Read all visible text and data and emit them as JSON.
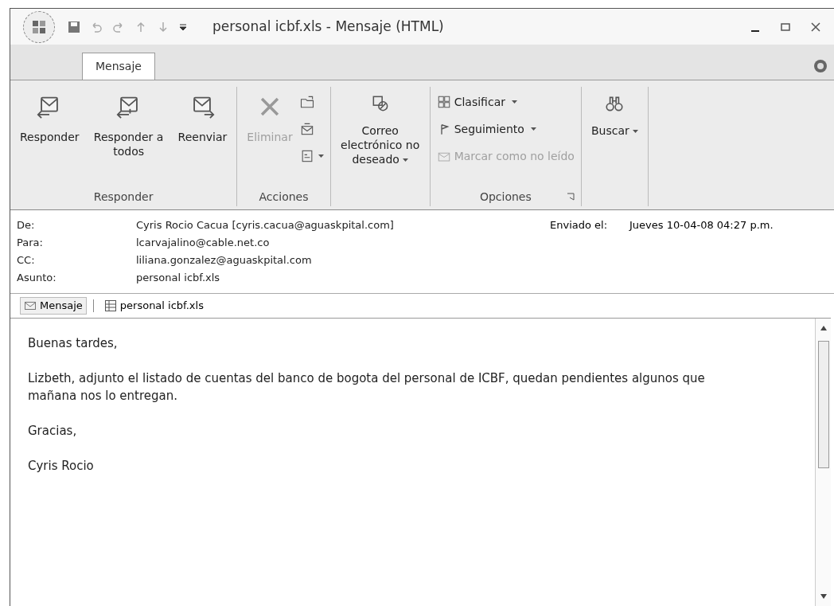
{
  "window": {
    "title": "personal icbf.xls - Mensaje (HTML)"
  },
  "ribbon_tabs": [
    {
      "label": "Mensaje",
      "selected": true
    }
  ],
  "ribbon_groups": [
    {
      "label": "Responder",
      "launcher": false,
      "items": [
        {
          "kind": "large",
          "label": "Responder",
          "disabled": false,
          "dropdown": false
        },
        {
          "kind": "large",
          "label": "Responder a todos",
          "disabled": false,
          "dropdown": false
        },
        {
          "kind": "large",
          "label": "Reenviar",
          "disabled": false,
          "dropdown": false
        }
      ]
    },
    {
      "label": "Acciones",
      "launcher": false,
      "items": [
        {
          "kind": "large",
          "label": "Eliminar",
          "disabled": true,
          "dropdown": false
        },
        {
          "kind": "icon",
          "disabled": false,
          "dropdown": false
        },
        {
          "kind": "icon",
          "disabled": false,
          "dropdown": false
        },
        {
          "kind": "icon",
          "disabled": false,
          "dropdown": true
        }
      ]
    },
    {
      "launcher": false,
      "items": [
        {
          "kind": "large",
          "label": "Correo electrónico no deseado",
          "disabled": false,
          "dropdown": true
        }
      ]
    },
    {
      "label": "Opciones",
      "launcher": true,
      "items": [
        {
          "kind": "small",
          "label": "Clasificar",
          "disabled": false,
          "dropdown": true
        },
        {
          "kind": "small",
          "label": "Seguimiento",
          "disabled": false,
          "dropdown": true
        },
        {
          "kind": "small",
          "label": "Marcar como no leído",
          "disabled": true,
          "dropdown": false
        }
      ]
    },
    {
      "launcher": false,
      "items": [
        {
          "kind": "large",
          "label": "Buscar",
          "disabled": false,
          "dropdown": true
        }
      ]
    }
  ],
  "header_fields": [
    {
      "label": "De:",
      "value": "Cyris Rocio Cacua [cyris.cacua@aguaskpital.com]"
    },
    {
      "label": "Para:",
      "value": "lcarvajalino@cable.net.co"
    },
    {
      "label": "CC:",
      "value": "liliana.gonzalez@aguaskpital.com"
    },
    {
      "label": "Asunto:",
      "value": "personal icbf.xls"
    }
  ],
  "sent": {
    "label": "Enviado el:",
    "value": "Jueves 10-04-08 04:27 p.m."
  },
  "attachments": [
    {
      "label": "Mensaje",
      "kind": "message",
      "selected": true
    },
    {
      "label": "personal icbf.xls",
      "kind": "excel",
      "selected": false
    }
  ],
  "body": [
    "Buenas tardes,",
    "Lizbeth, adjunto el listado de cuentas del banco de bogota del personal de ICBF, quedan pendientes algunos que mañana nos lo entregan.",
    "Gracias,",
    "Cyris Rocio"
  ]
}
